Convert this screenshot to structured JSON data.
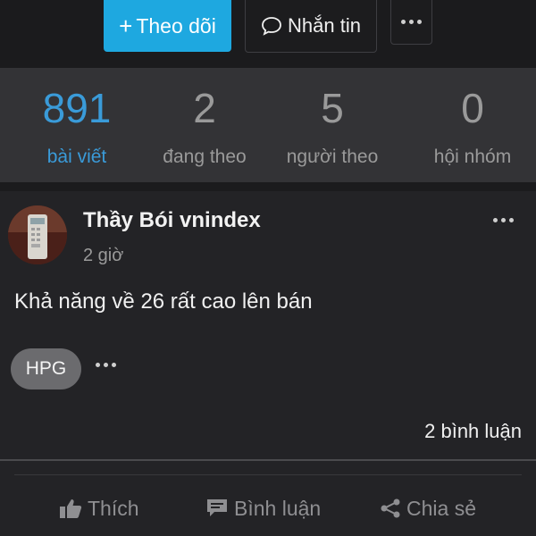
{
  "header": {
    "follow_label": "Theo dõi",
    "follow_plus": "+",
    "message_label": "Nhắn tin"
  },
  "stats": [
    {
      "value": "891",
      "label": "bài viết",
      "active": true
    },
    {
      "value": "2",
      "label": "đang theo",
      "active": false
    },
    {
      "value": "5",
      "label": "người theo",
      "active": false
    },
    {
      "value": "0",
      "label": "hội nhóm",
      "active": false
    }
  ],
  "post": {
    "author": "Thầy Bói vnindex",
    "time": "2 giờ",
    "content": "Khả năng về 26 rất cao lên bán",
    "tag": "HPG",
    "comments": "2 bình luận",
    "actions": {
      "like": "Thích",
      "comment": "Bình luận",
      "share": "Chia sẻ"
    }
  },
  "colors": {
    "accent": "#1ea8e0",
    "active_stat": "#3a9bd9",
    "background": "#1b1b1d",
    "stats_bg": "#333336",
    "card_bg": "#232326"
  },
  "icons": {
    "message": "speech-bubble-icon",
    "more": "ellipsis-icon",
    "like": "thumbs-up-icon",
    "comment": "comment-icon",
    "share": "share-icon"
  }
}
